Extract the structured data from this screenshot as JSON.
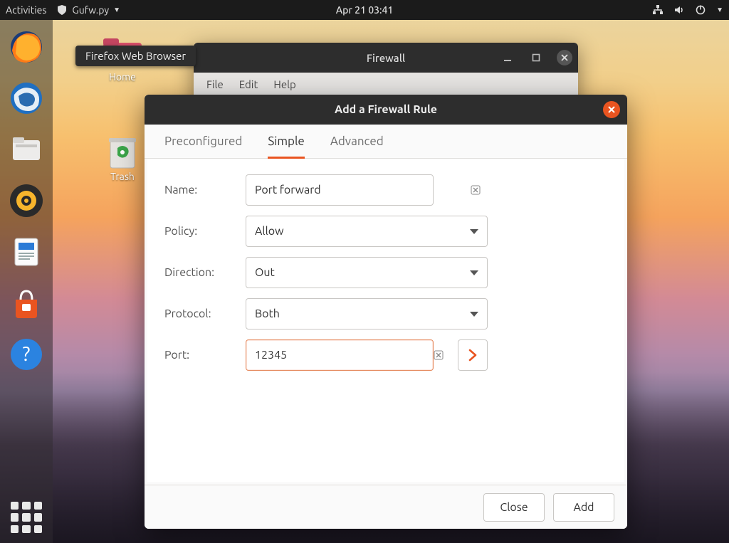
{
  "topbar": {
    "activities": "Activities",
    "app_name": "Gufw.py",
    "datetime": "Apr 21  03:41"
  },
  "tooltip": {
    "text": "Firefox Web Browser"
  },
  "desktop": {
    "home_label": "Home",
    "trash_label": "Trash"
  },
  "firewall_window": {
    "title": "Firewall",
    "menu": {
      "file": "File",
      "edit": "Edit",
      "help": "Help"
    }
  },
  "dialog": {
    "title": "Add a Firewall Rule",
    "tabs": {
      "preconfigured": "Preconfigured",
      "simple": "Simple",
      "advanced": "Advanced"
    },
    "fields": {
      "name_label": "Name:",
      "name_value": "Port forward",
      "policy_label": "Policy:",
      "policy_value": "Allow",
      "direction_label": "Direction:",
      "direction_value": "Out",
      "protocol_label": "Protocol:",
      "protocol_value": "Both",
      "port_label": "Port:",
      "port_value": "12345"
    },
    "buttons": {
      "close": "Close",
      "add": "Add"
    }
  }
}
